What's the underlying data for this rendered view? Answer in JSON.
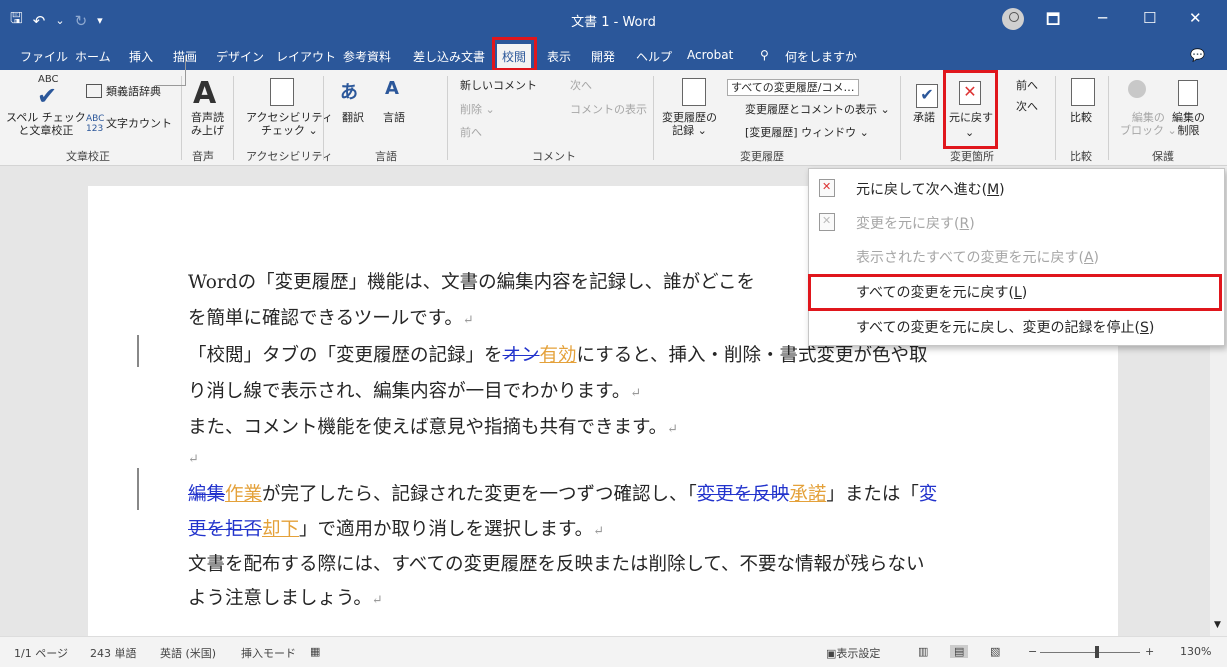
{
  "window": {
    "title": "文書 1  -  Word"
  },
  "qat": {
    "save": "🖫",
    "undo": "↶",
    "undo_arrow": "⌄",
    "redo": "↻",
    "customize": "▾"
  },
  "window_controls": {
    "ribbon_display": "🗖",
    "minimize": "─",
    "maximize": "☐",
    "close": "✕"
  },
  "tabs": [
    "ファイル",
    "ホーム",
    "挿入",
    "描画",
    "デザイン",
    "レイアウト",
    "参考資料",
    "差し込み文書",
    "校閲",
    "表示",
    "開発",
    "ヘルプ",
    "Acrobat"
  ],
  "active_tab": "校閲",
  "tell_me": "何をしますか",
  "ribbon": {
    "proofing": {
      "spell": "スペル チェック\nと文章校正",
      "thesaurus": "類義語辞典",
      "wordcount": "文字カウント",
      "abc": "ABC",
      "label": "文章校正"
    },
    "speech": {
      "read_aloud": "音声読\nみ上げ",
      "label": "音声"
    },
    "accessibility": {
      "check": "アクセシビリティ\nチェック ⌄",
      "label": "アクセシビリティ"
    },
    "language": {
      "translate": "翻訳",
      "language": "言語",
      "label": "言語"
    },
    "comments": {
      "new": "新しいコメント",
      "delete": "削除 ⌄",
      "prev": "前へ",
      "next": "次へ",
      "show": "コメントの表示",
      "label": "コメント"
    },
    "tracking": {
      "track": "変更履歴の\n記録 ⌄",
      "markup": "すべての変更履歴/コメ…",
      "show_markup": "変更履歴とコメントの表示 ⌄",
      "pane": "[変更履歴] ウィンドウ ⌄",
      "label": "変更履歴"
    },
    "changes": {
      "accept": "承諾",
      "reject": "元に戻す",
      "prev": "前へ",
      "next": "次へ",
      "label": "変更箇所"
    },
    "compare": {
      "compare": "比較",
      "label": "比較"
    },
    "protect": {
      "block": "編集の\nブロック ⌄",
      "restrict": "編集の\n制限",
      "label": "保護"
    }
  },
  "document": {
    "para1_line1": "Wordの「変更履歴」機能は、文書の編集内容を記録し、誰がどこを",
    "para1_line2": "を簡単に確認できるツールです。",
    "para2_a": "「校閲」タブの「変更履歴の記録」を",
    "para2_del": "オン",
    "para2_ins": "有効",
    "para2_b": "にすると、挿入・削除・書式変更が色や取",
    "para2_line2": "り消し線で表示され、編集内容が一目でわかります。",
    "para3": "また、コメント機能を使えば意見や指摘も共有できます。",
    "para5_del1": "編集",
    "para5_ins1": "作業",
    "para5_a": "が完了したら、記録された変更を一つずつ確認し、「",
    "para5_del2": "変更を反映",
    "para5_ins2": "承諾",
    "para5_b": "」または「",
    "para5_c": "変",
    "para5_del3": "更を拒否",
    "para5_ins3": "却下",
    "para5_d": "」で適用か取り消しを選択します。",
    "para6_line1": "文書を配布する際には、すべての変更履歴を反映または削除して、不要な情報が残らない",
    "para6_line2": "よう注意しましょう。",
    "para_mark": "↵"
  },
  "dropdown": {
    "items": [
      {
        "label": "元に戻して次へ進む",
        "key": "M",
        "enabled": true
      },
      {
        "label": "変更を元に戻す",
        "key": "R",
        "enabled": false
      },
      {
        "label": "表示されたすべての変更を元に戻す",
        "key": "A",
        "enabled": false
      },
      {
        "label": "すべての変更を元に戻す",
        "key": "L",
        "enabled": true,
        "highlighted": true
      },
      {
        "label": "すべての変更を元に戻し、変更の記録を停止",
        "key": "S",
        "enabled": true
      }
    ]
  },
  "status": {
    "page": "1/1 ページ",
    "words": "243 単語",
    "language": "英語 (米国)",
    "mode": "挿入モード",
    "display": "表示設定",
    "zoom_minus": "−",
    "zoom_plus": "+",
    "zoom": "130%"
  },
  "colors": {
    "title_bar": "#2b579a",
    "highlight_box": "#e0161c",
    "insertion": "#e4a13a",
    "deletion": "#2233cc"
  },
  "icons": [
    "save-icon",
    "undo-icon",
    "redo-icon",
    "account-icon",
    "ribbon-display-icon",
    "minimize-icon",
    "maximize-icon",
    "close-icon",
    "share-icon",
    "lightbulb-icon",
    "reject-icon",
    "accept-icon"
  ]
}
